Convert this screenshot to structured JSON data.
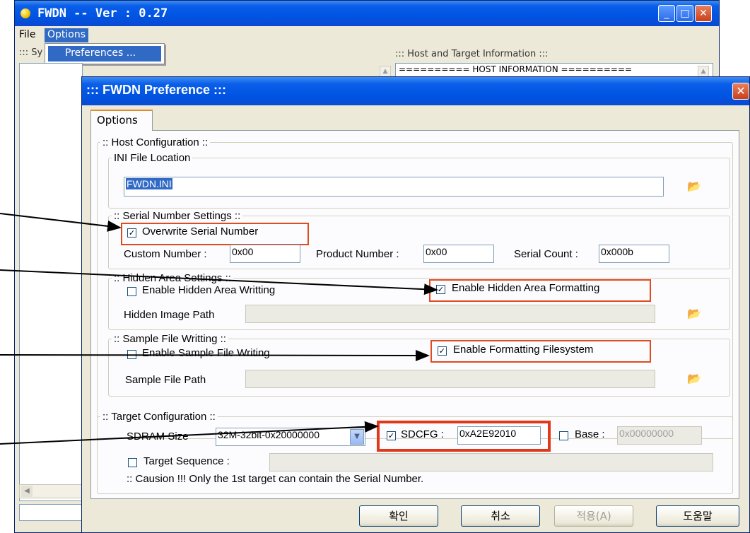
{
  "colors": {
    "title_blue": "#0054e3",
    "highlight_red": "#e04b1f",
    "dialog_bg": "#ece9d8"
  },
  "main_window": {
    "title": "FWDN -- Ver : 0.27",
    "menu": {
      "file": "File",
      "options": "Options"
    },
    "dropdown_item": "Preferences ...",
    "left_label": "::: Sy",
    "host_label": "::: Host and Target Information :::",
    "host_info_text": "========== HOST INFORMATION ==========",
    "icons": [
      "minimize-icon",
      "maximize-icon",
      "close-icon"
    ]
  },
  "dialog": {
    "title": "::: FWDN Preference :::",
    "tab": "Options",
    "host_config": {
      "legend": ":: Host Configuration ::",
      "ini": {
        "legend": "INI File Location",
        "value": "FWDN.INI"
      }
    },
    "serial": {
      "legend": ":: Serial Number Settings ::",
      "overwrite_label": "Overwrite Serial Number",
      "overwrite_checked": true,
      "custom_label": "Custom Number :",
      "custom_value": "0x00",
      "product_label": "Product Number :",
      "product_value": "0x00",
      "count_label": "Serial Count :",
      "count_value": "0x000b"
    },
    "hidden": {
      "legend": ":: Hidden Area Settings ::",
      "writing_label": "Enable Hidden Area Writting",
      "writing_checked": false,
      "formatting_label": "Enable Hidden Area Formatting",
      "formatting_checked": true,
      "image_path_label": "Hidden Image Path",
      "image_path_value": ""
    },
    "sample": {
      "legend": ":: Sample File Writting ::",
      "writing_label": "Enable Sample File Writing",
      "writing_checked": false,
      "fs_label": "Enable Formatting Filesystem",
      "fs_checked": true,
      "path_label": "Sample File Path",
      "path_value": ""
    },
    "target": {
      "legend": ":: Target Configuration ::",
      "sdram_label": "SDRAM Size",
      "sdram_value": "32M-32bit-0x20000000",
      "sdcfg_label": "SDCFG :",
      "sdcfg_checked": true,
      "sdcfg_value": "0xA2E92010",
      "base_label": "Base :",
      "base_checked": false,
      "base_value": "0x00000000",
      "sequence_label": "Target Sequence :",
      "sequence_checked": false,
      "caution": ":: Causion !!! Only the 1st target can contain the Serial Number."
    },
    "buttons": {
      "ok": "확인",
      "cancel": "취소",
      "apply": "적용(A)",
      "help": "도움말"
    }
  }
}
